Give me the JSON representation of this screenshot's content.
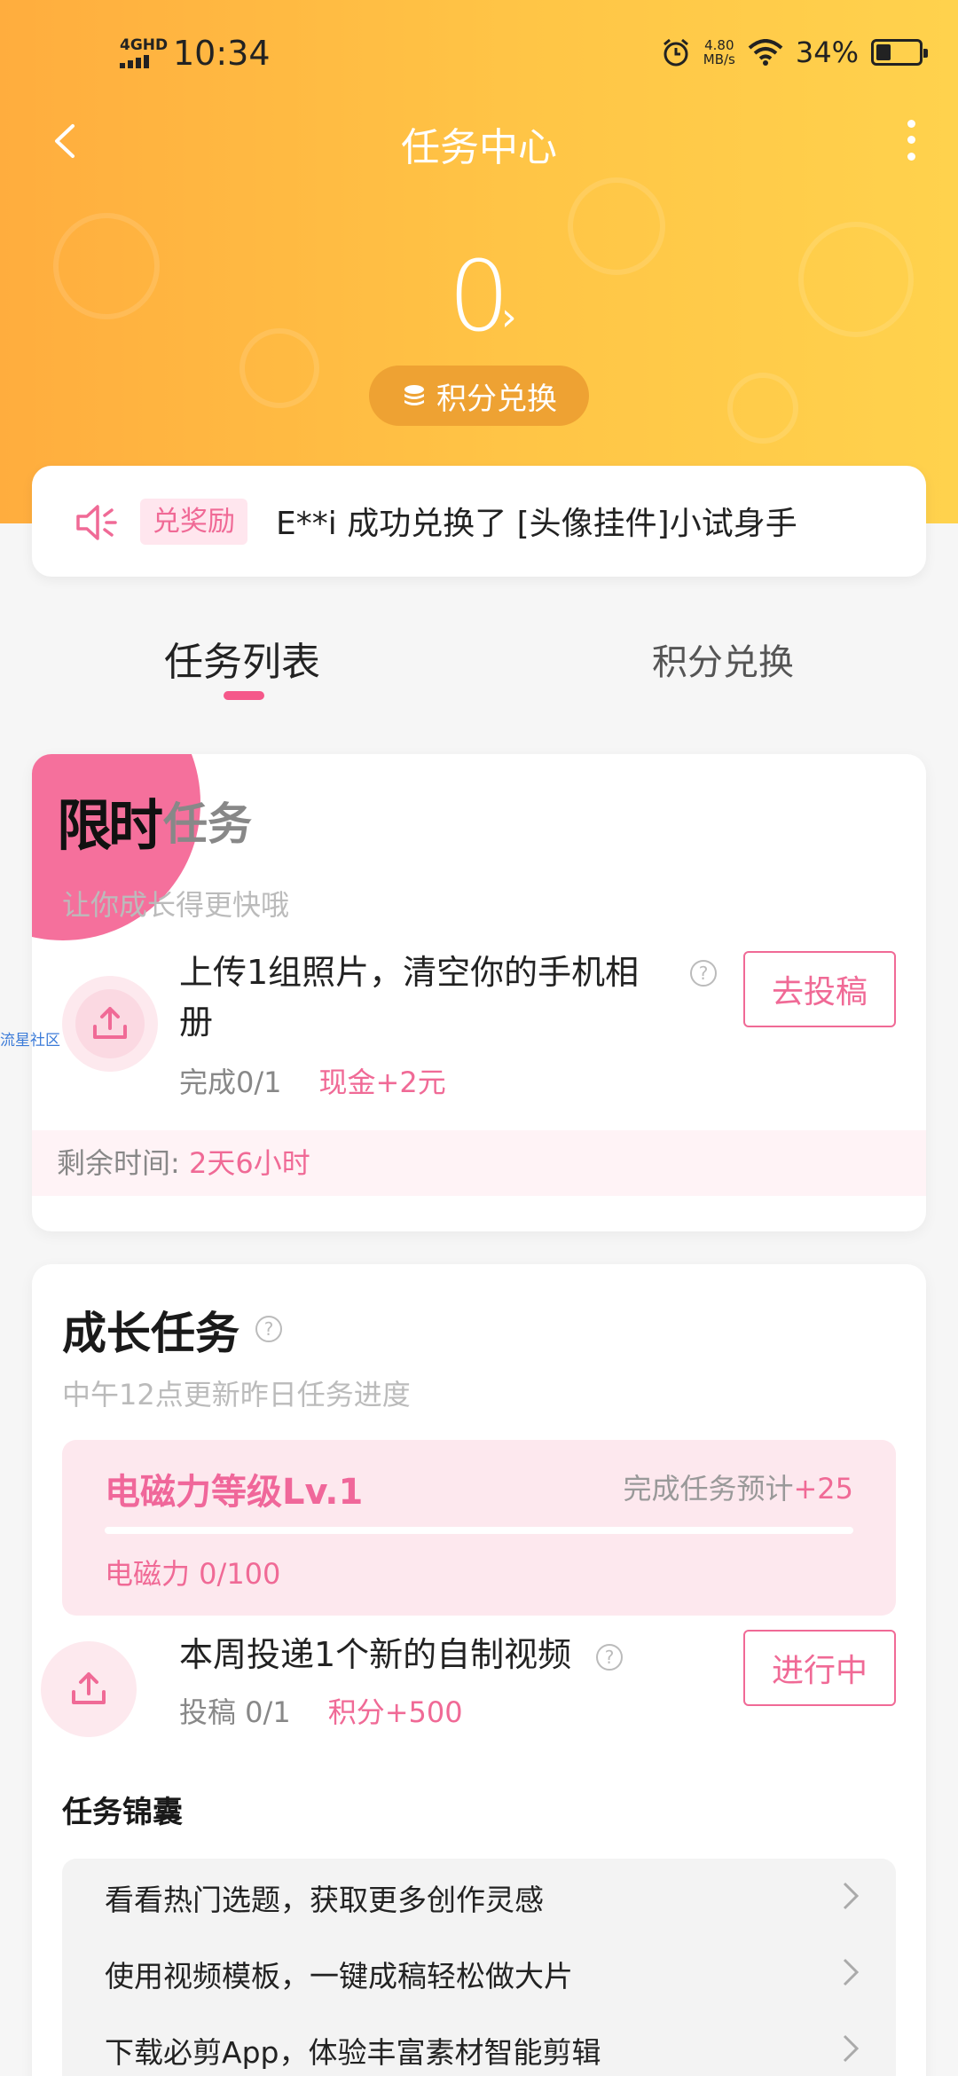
{
  "status": {
    "network": "4GHD",
    "time": "10:34",
    "speed_value": "4.80",
    "speed_unit": "MB/s",
    "battery": "34%"
  },
  "header": {
    "title": "任务中心",
    "points": "0",
    "exchange_label": "积分兑换"
  },
  "notice": {
    "tag": "兑奖励",
    "text": "E**i 成功兑换了 [头像挂件]小试身手"
  },
  "tabs": [
    {
      "label": "任务列表",
      "active": true
    },
    {
      "label": "积分兑换",
      "active": false
    }
  ],
  "limited": {
    "logo": "限时",
    "word": "任务",
    "subtitle": "让你成长得更快哦",
    "task": {
      "title_line1": "上传1组照片，清空你的手机相",
      "title_line2": "册",
      "progress": "完成0/1",
      "reward": "现金+2元",
      "button": "去投稿"
    },
    "remaining_label": "剩余时间:",
    "remaining_value": "2天6小时"
  },
  "watermark": "流星社区",
  "growth": {
    "title": "成长任务",
    "subtitle": "中午12点更新昨日任务进度",
    "level": {
      "name": "电磁力等级Lv.1",
      "estimate_label": "完成任务预计",
      "estimate_value": "+25",
      "power": "电磁力 0/100",
      "progress_fraction": 0
    },
    "task": {
      "title": "本周投递1个新的自制视频",
      "progress": "投稿 0/1",
      "reward": "积分+500",
      "button": "进行中"
    },
    "pouch_title": "任务锦囊",
    "pouch_items": [
      "看看热门选题，获取更多创作灵感",
      "使用视频模板，一键成稿轻松做大片",
      "下载必剪App，体验丰富素材智能剪辑"
    ]
  },
  "colors": {
    "accent": "#f06a96",
    "header_start": "#ffad3e",
    "header_end": "#ffd24d"
  }
}
